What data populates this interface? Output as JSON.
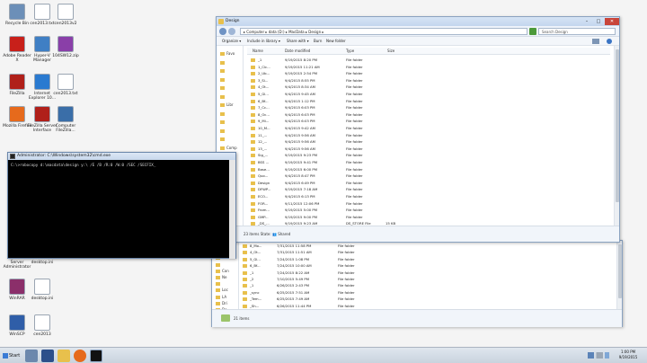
{
  "desktop_icons": [
    {
      "label": "Recycle Bin",
      "color": "#6c8fb8"
    },
    {
      "label": "cen2013.txt",
      "color": "#ffffff"
    },
    {
      "label": "cen2013v2",
      "color": "#ffffff"
    },
    {
      "label": "Adobe Reader X",
      "color": "#c8201a"
    },
    {
      "label": "Hyper-V Manager",
      "color": "#3f7fc4"
    },
    {
      "label": "104SW12.zip",
      "color": "#8a3fa8"
    },
    {
      "label": "FileZilla",
      "color": "#b0201a"
    },
    {
      "label": "Internet Explorer 10...",
      "color": "#2a7ad0"
    },
    {
      "label": "cen2013.txt",
      "color": "#ffffff"
    },
    {
      "label": "Mozilla Firefox",
      "color": "#e66a1c"
    },
    {
      "label": "FileZilla Server Interface",
      "color": "#b0201a"
    },
    {
      "label": "Computer FileZilla...",
      "color": "#3a6ea8"
    },
    {
      "label": "Server Administrator",
      "color": "#5a7aa0"
    },
    {
      "label": "desktop.ini",
      "color": "#ffffff"
    },
    {
      "label": "WinRAR",
      "color": "#8b2f6a"
    },
    {
      "label": "desktop.ini",
      "color": "#ffffff"
    },
    {
      "label": "WinSCP",
      "color": "#2f5ea8"
    },
    {
      "label": "cen2013",
      "color": "#ffffff"
    }
  ],
  "explorer_top": {
    "title": "Design",
    "address": "▸ Computer ▸ data (D:) ▸ MacData ▸ Design ▸",
    "search_placeholder": "Search Design",
    "toolbar": [
      "Organize ▾",
      "Include in library ▾",
      "Share with ▾",
      "Burn",
      "New folder"
    ],
    "columns": [
      "Name",
      "Date modified",
      "Type",
      "Size"
    ],
    "nav_items": [
      "Favo",
      "",
      "",
      "",
      "",
      "",
      "Libr",
      "",
      "",
      "",
      "",
      "Comp",
      "",
      "",
      "",
      "Net"
    ],
    "rows": [
      {
        "name": "_1",
        "date": "9/19/2015 8:20 PM",
        "type": "File folder",
        "size": ""
      },
      {
        "name": "1_Clc...",
        "date": "9/19/2015 11:21 AM",
        "type": "File folder",
        "size": ""
      },
      {
        "name": "2_Ub...",
        "date": "9/19/2015 2:54 PM",
        "type": "File folder",
        "size": ""
      },
      {
        "name": "3_Si...",
        "date": "9/4/2015 8:55 PM",
        "type": "File folder",
        "size": ""
      },
      {
        "name": "4_Ot...",
        "date": "9/4/2015 8:34 AM",
        "type": "File folder",
        "size": ""
      },
      {
        "name": "5_Gl...",
        "date": "9/4/2015 9:45 AM",
        "type": "File folder",
        "size": ""
      },
      {
        "name": "6_Bf...",
        "date": "9/4/2015 1:12 PM",
        "type": "File folder",
        "size": ""
      },
      {
        "name": "7_Cc...",
        "date": "9/4/2015 6:03 PM",
        "type": "File folder",
        "size": ""
      },
      {
        "name": "8_Oc...",
        "date": "9/4/2015 6:03 PM",
        "type": "File folder",
        "size": ""
      },
      {
        "name": "9_Mi...",
        "date": "9/4/2015 6:03 PM",
        "type": "File folder",
        "size": ""
      },
      {
        "name": "10_M...",
        "date": "9/4/2015 9:42 AM",
        "type": "File folder",
        "size": ""
      },
      {
        "name": "11_...",
        "date": "9/4/2015 9:56 AM",
        "type": "File folder",
        "size": ""
      },
      {
        "name": "12_...",
        "date": "9/4/2015 9:56 AM",
        "type": "File folder",
        "size": ""
      },
      {
        "name": "13_...",
        "date": "9/4/2015 9:56 AM",
        "type": "File folder",
        "size": ""
      },
      {
        "name": "Sig_...",
        "date": "9/19/2015 9:23 PM",
        "type": "File folder",
        "size": ""
      },
      {
        "name": "BSS ...",
        "date": "9/19/2015 9:41 PM",
        "type": "File folder",
        "size": ""
      },
      {
        "name": "Base...",
        "date": "9/19/2015 6:00 PM",
        "type": "File folder",
        "size": ""
      },
      {
        "name": "Quo...",
        "date": "9/4/2015 8:47 PM",
        "type": "File folder",
        "size": ""
      },
      {
        "name": "Design",
        "date": "9/4/2015 6:49 PM",
        "type": "File folder",
        "size": ""
      },
      {
        "name": "DFWP...",
        "date": "9/19/2015 7:18 AM",
        "type": "File folder",
        "size": ""
      },
      {
        "name": "ECO...",
        "date": "9/4/2015 6:13 PM",
        "type": "File folder",
        "size": ""
      },
      {
        "name": "FOR...",
        "date": "9/11/2015 12:06 PM",
        "type": "File folder",
        "size": ""
      },
      {
        "name": "From...",
        "date": "9/19/2015 5:00 PM",
        "type": "File folder",
        "size": ""
      },
      {
        "name": "GMP...",
        "date": "9/19/2015 9:00 PM",
        "type": "File folder",
        "size": ""
      },
      {
        "name": "_DS_...",
        "date": "9/19/2015 9:23 AM",
        "type": "DS_STORE File",
        "size": "15 KB"
      }
    ],
    "status": "23 items  State: 👥 Shared"
  },
  "explorer_bottom": {
    "rows": [
      {
        "name": "8_Mo...",
        "date": "7/31/2015 11:58 PM",
        "type": "File folder"
      },
      {
        "name": "4_Ot...",
        "date": "7/31/2015 11:51 AM",
        "type": "File folder"
      },
      {
        "name": "5_Gl...",
        "date": "7/24/2015 1:08 PM",
        "type": "File folder"
      },
      {
        "name": "6_Bf...",
        "date": "7/24/2015 10:00 AM",
        "type": "File folder"
      },
      {
        "name": "_1",
        "date": "7/24/2015 8:22 AM",
        "type": "File folder"
      },
      {
        "name": "_2",
        "date": "7/10/2015 5:49 PM",
        "type": "File folder"
      },
      {
        "name": "_1",
        "date": "6/26/2015 2:43 PM",
        "type": "File folder"
      },
      {
        "name": "_sync",
        "date": "6/25/2015 7:51 AM",
        "type": "File folder"
      },
      {
        "name": "_Tem...",
        "date": "6/25/2015 7:49 AM",
        "type": "File folder"
      },
      {
        "name": "_Sh...",
        "date": "6/26/2015 11:44 PM",
        "type": "File folder"
      }
    ],
    "nav_items": [
      "Hi",
      "NV",
      "Vid",
      "",
      "Con",
      "Ne",
      "",
      "Loc",
      "LA",
      "Dri",
      "Do"
    ],
    "status": "21 items"
  },
  "cmd": {
    "title": "Administrator: C:\\Windows\\system32\\cmd.exe",
    "line1": "C:\\>robocopy d:\\macdata\\design y:\\ /E /B /R:0 /W:0 /SEC /SECFIX_"
  },
  "taskbar": {
    "start_label": "Start",
    "time": "1:00 PM",
    "date": "9/19/2015"
  }
}
